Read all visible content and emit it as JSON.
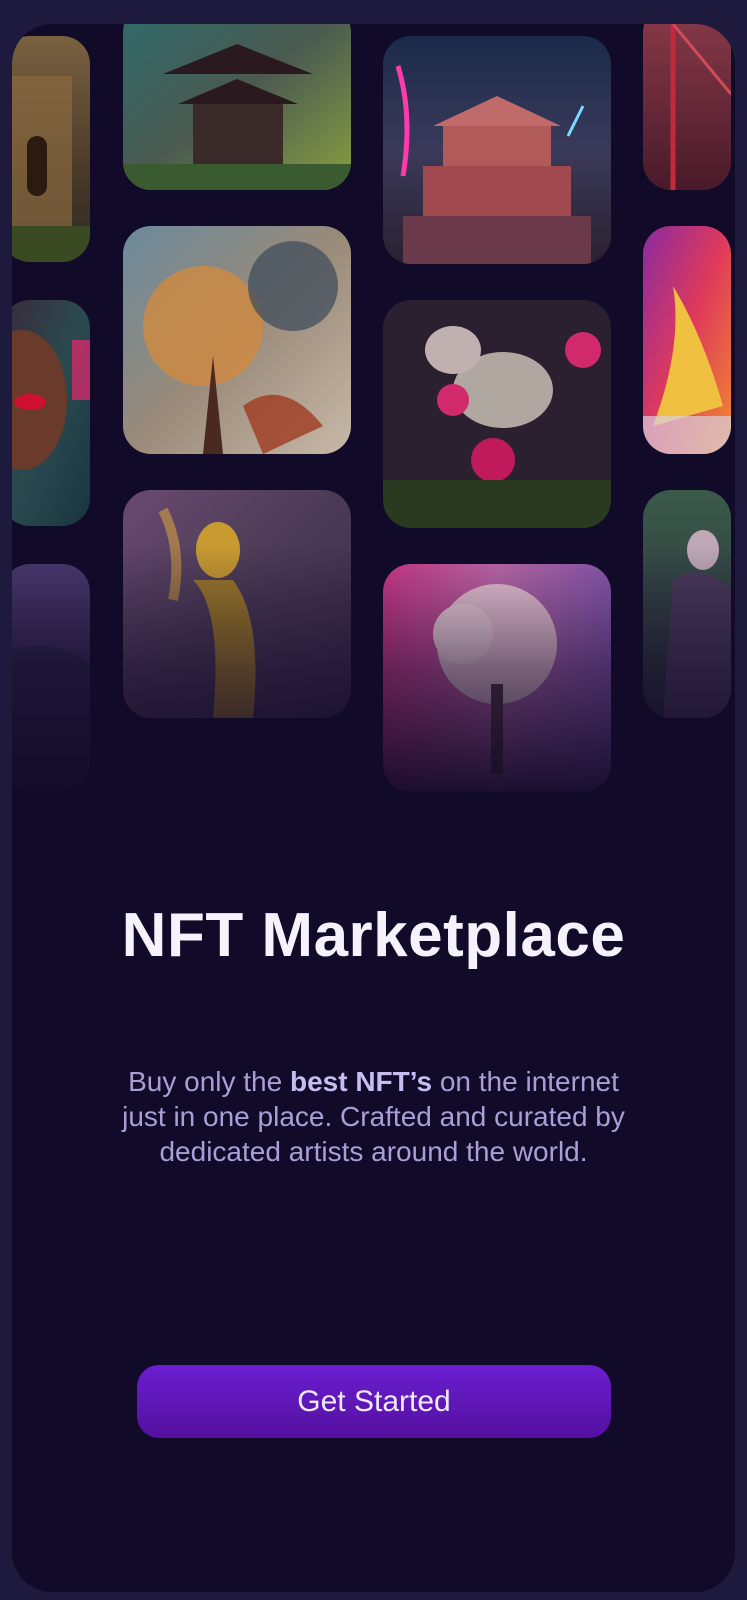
{
  "onboarding": {
    "title": "NFT Marketplace",
    "description": {
      "before": "Buy only the ",
      "highlight": "best NFT’s",
      "after": " on the internet just in one place. Crafted and curated by dedicated artists around the world."
    },
    "cta_label": "Get Started"
  },
  "gallery": {
    "artworks": [
      "castle-ruins-artwork",
      "asian-temple-artwork",
      "neon-temple-artwork",
      "red-bridge-artwork",
      "portrait-artwork",
      "autumn-tree-artwork",
      "skull-roses-artwork",
      "fire-abstract-artwork",
      "dusk-landscape-artwork",
      "golden-figure-artwork",
      "blossom-tree-artwork",
      "dark-figure-artwork"
    ]
  },
  "colors": {
    "background": "#110a28",
    "accent": "#6a1ed0",
    "title": "#f4f2fb",
    "body_text": "#a99fd6"
  }
}
